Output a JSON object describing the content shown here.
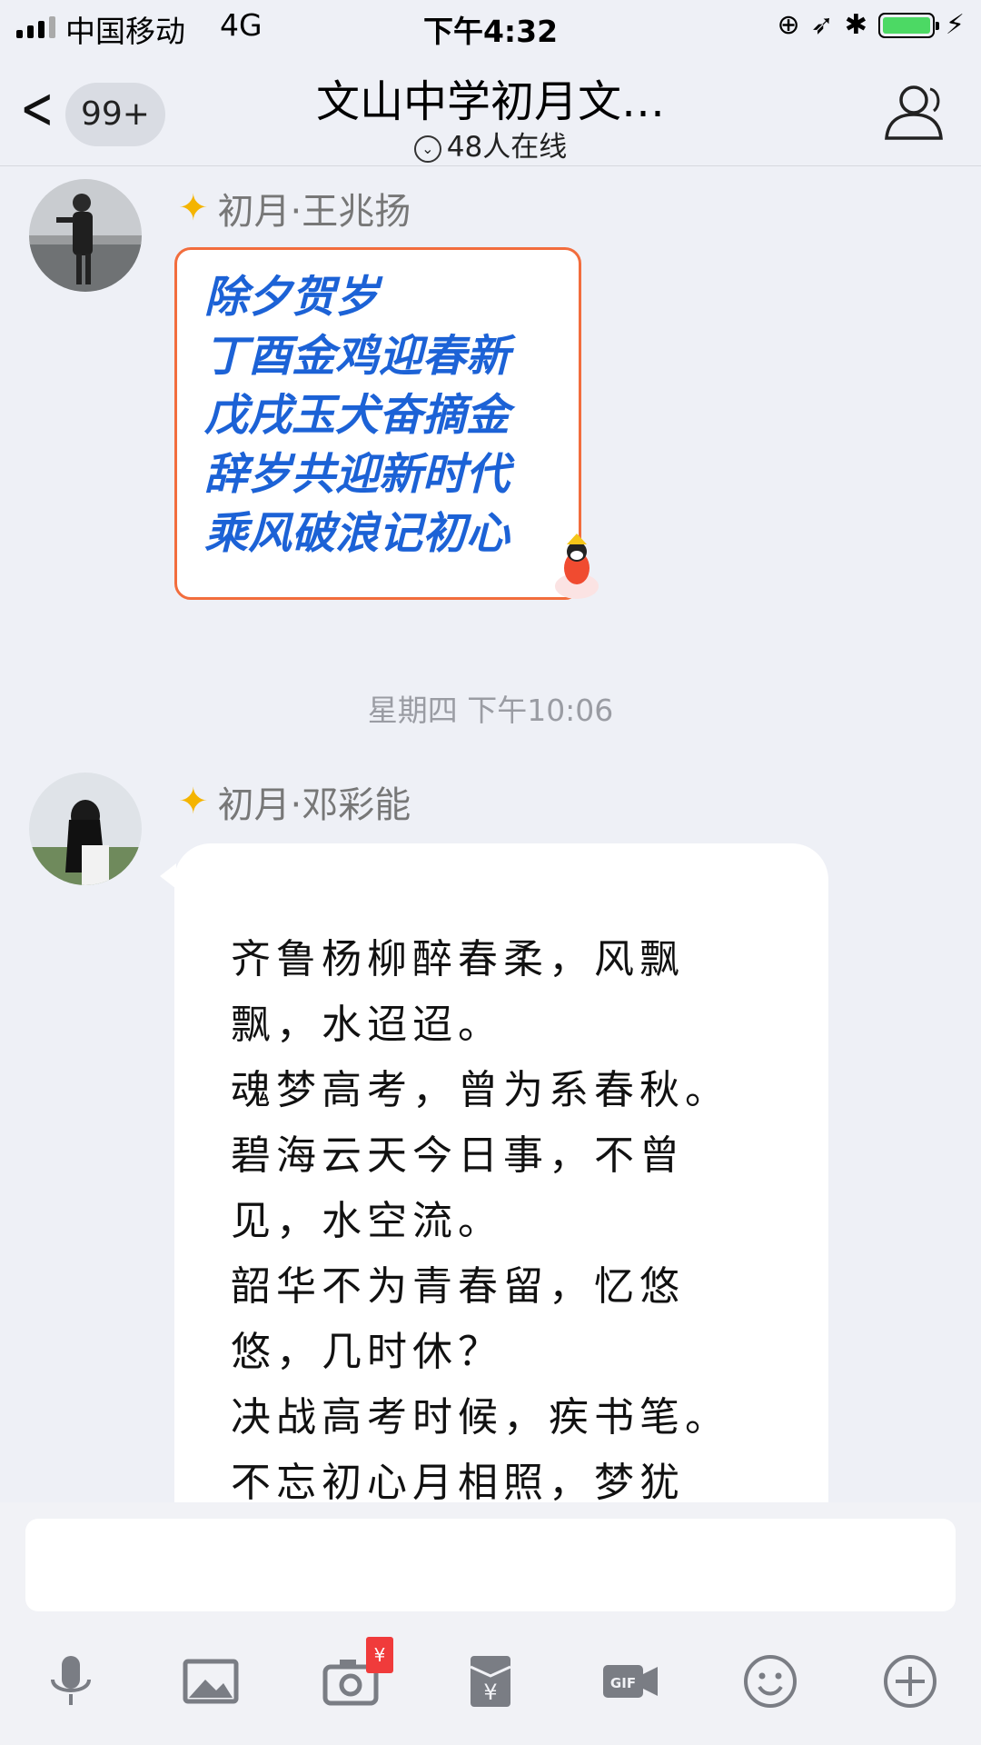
{
  "status_bar": {
    "carrier": "中国移动",
    "network": "4G",
    "time": "下午4:32"
  },
  "nav": {
    "unread_badge": "99+",
    "title": "文山中学初月文…",
    "online_count": "48人在线"
  },
  "messages": [
    {
      "sender": "初月·王兆扬",
      "card_lines": [
        "除夕贺岁",
        "丁酉金鸡迎春新",
        "戊戌玉犬奋摘金",
        "辞岁共迎新时代",
        "乘风破浪记初心"
      ]
    },
    {
      "timestamp": "星期四 下午10:06"
    },
    {
      "sender": "初月·邓彩能",
      "poem_lines": [
        "齐鲁杨柳醉春柔，风飘",
        "飘，水迢迢。",
        "魂梦高考，曾为系春秋。",
        "碧海云天今日事，不曾",
        "见，水空流。",
        "韶华不为青春留，忆悠",
        "悠，几时休？",
        "决战高考时候，疾书笔。",
        "不忘初心月相照，梦犹"
      ]
    }
  ],
  "toolbar": {
    "icons": [
      "microphone-icon",
      "image-icon",
      "camera-icon",
      "red-packet-icon",
      "gif-icon",
      "emoji-icon",
      "plus-icon"
    ],
    "camera_tag": "¥"
  },
  "colors": {
    "card_text": "#1c62d6",
    "card_border": "#f26d3d",
    "battery": "#4cd964",
    "background": "#eef0f6"
  }
}
